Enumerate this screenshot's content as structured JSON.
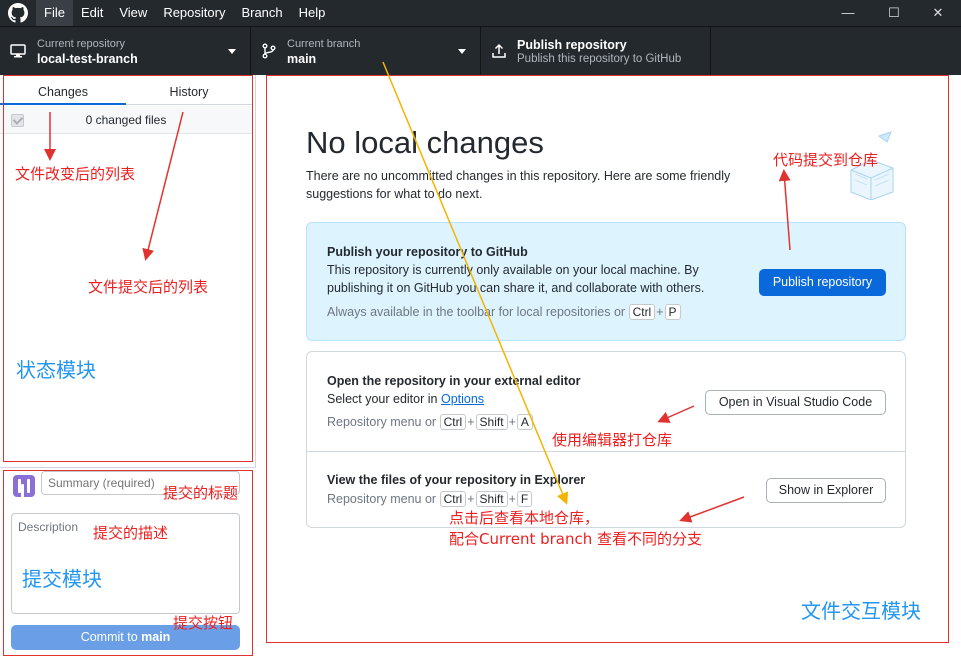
{
  "menubar": {
    "items": [
      "File",
      "Edit",
      "View",
      "Repository",
      "Branch",
      "Help"
    ],
    "window_controls": {
      "minimize": "—",
      "maximize": "☐",
      "close": "✕"
    }
  },
  "toolbar": {
    "current_repository_label": "Current repository",
    "current_repository_value": "local-test-branch",
    "current_branch_label": "Current branch",
    "current_branch_value": "main",
    "publish_title": "Publish repository",
    "publish_subtitle": "Publish this repository to GitHub"
  },
  "sidebar": {
    "tabs": [
      "Changes",
      "History"
    ],
    "changed_files": "0 changed files"
  },
  "commit": {
    "summary_placeholder": "Summary (required)",
    "description_placeholder": "Description",
    "button_prefix": "Commit to ",
    "button_branch": "main"
  },
  "main": {
    "heading": "No local changes",
    "intro": "There are no uncommitted changes in this repository. Here are some friendly suggestions for what to do next.",
    "publish_card": {
      "title": "Publish your repository to GitHub",
      "text": "This repository is currently only available on your local machine. By publishing it on GitHub you can share it, and collaborate with others.",
      "hint_prefix": "Always available in the toolbar for local repositories or",
      "keys": [
        "Ctrl",
        "P"
      ],
      "button": "Publish repository"
    },
    "editor_card": {
      "title": "Open the repository in your external editor",
      "text_prefix": "Select your editor in",
      "text_link": "Options",
      "hint_prefix": "Repository menu or",
      "keys": [
        "Ctrl",
        "Shift",
        "A"
      ],
      "button": "Open in Visual Studio Code"
    },
    "explorer_card": {
      "title": "View the files of your repository in Explorer",
      "hint_prefix": "Repository menu or",
      "keys": [
        "Ctrl",
        "Shift",
        "F"
      ],
      "button": "Show in Explorer"
    }
  },
  "annotations": {
    "file_changed_list": "文件改变后的列表",
    "file_committed_list": "文件提交后的列表",
    "status_module": "状态模块",
    "commit_title": "提交的标题",
    "commit_desc": "提交的描述",
    "commit_module": "提交模块",
    "commit_button": "提交按钮",
    "code_to_repo": "代码提交到仓库",
    "open_with_editor": "使用编辑器打仓库",
    "view_local_repo_line1": "点击后查看本地仓库，",
    "view_local_repo_line2": "配合Current branch 查看不同的分支",
    "file_interaction_module": "文件交互模块"
  },
  "colors": {
    "accent": "#0969da",
    "annotation_red": "#ec1f1f",
    "annotation_blue": "#2196f3",
    "arrow_yellow": "#f5b400",
    "titlebar": "#24292e"
  }
}
